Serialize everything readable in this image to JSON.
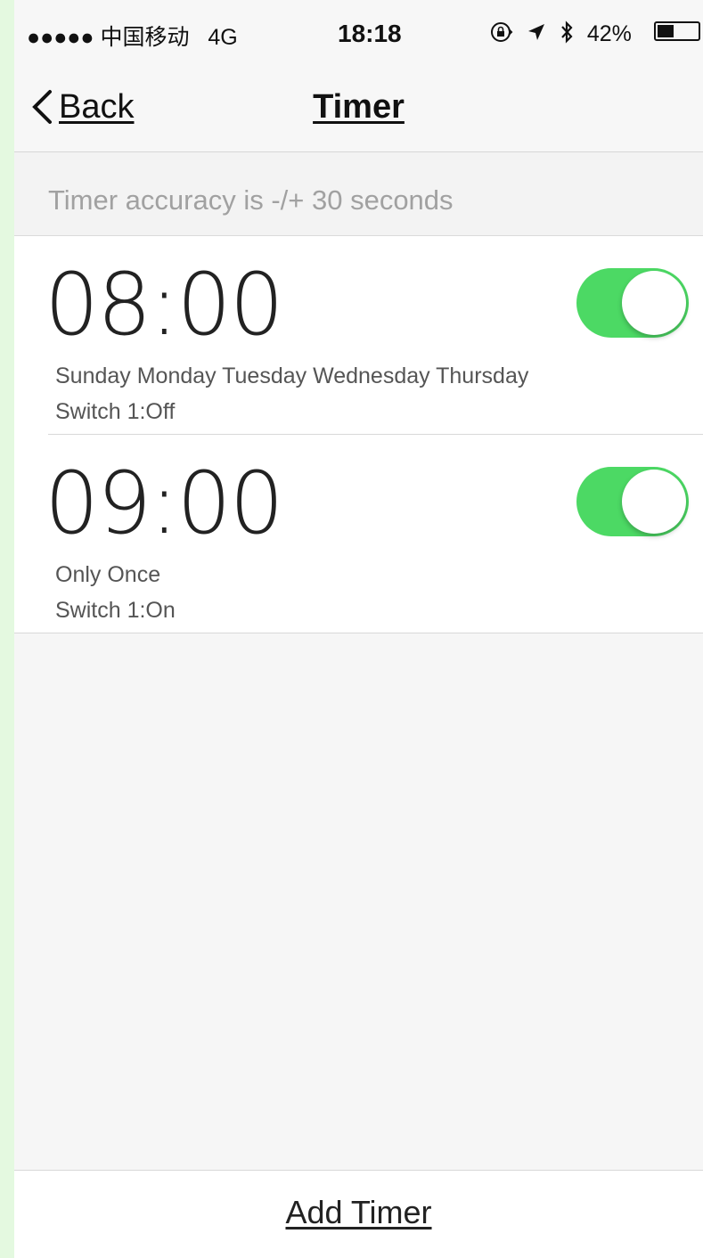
{
  "status_bar": {
    "signal_dots": "●●●●●",
    "carrier": "中国移动",
    "network": "4G",
    "time": "18:18",
    "battery_percent": "42%",
    "battery_level": 0.42
  },
  "nav": {
    "back_label": "Back",
    "title": "Timer"
  },
  "hint": "Timer accuracy is -/+ 30 seconds",
  "timers": [
    {
      "time": "08:00",
      "days": "Sunday Monday Tuesday Wednesday Thursday",
      "action": "Switch 1:Off",
      "enabled": true
    },
    {
      "time": "09:00",
      "days": "Only Once",
      "action": "Switch 1:On",
      "enabled": true
    }
  ],
  "footer": {
    "add_label": "Add Timer"
  },
  "colors": {
    "toggle_on": "#4cd964",
    "background": "#f6f6f6",
    "outer": "#e4f9e0"
  }
}
